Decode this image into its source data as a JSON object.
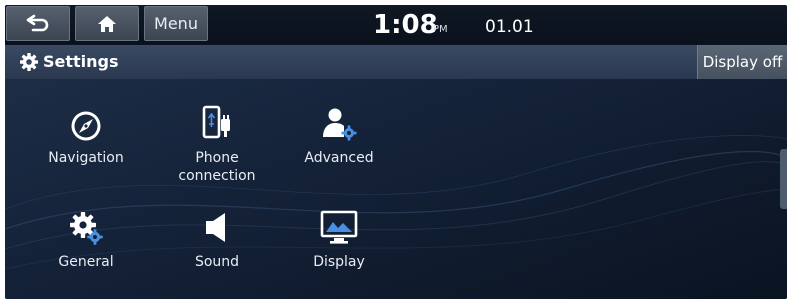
{
  "topbar": {
    "back_icon": "back-arrow-icon",
    "home_icon": "home-icon",
    "menu_label": "Menu",
    "time": "1:08",
    "ampm": "PM",
    "date": "01.01"
  },
  "titlebar": {
    "icon": "gear-icon",
    "title": "Settings",
    "display_off_label": "Display off"
  },
  "items": [
    {
      "label": "Navigation",
      "icon": "compass-icon"
    },
    {
      "label": "Phone\nconnection",
      "icon": "phone-connection-icon"
    },
    {
      "label": "Advanced",
      "icon": "advanced-user-gear-icon"
    },
    {
      "label": "General",
      "icon": "gears-icon"
    },
    {
      "label": "Sound",
      "icon": "speaker-icon"
    },
    {
      "label": "Display",
      "icon": "monitor-icon"
    }
  ],
  "colors": {
    "background": "#0b1422",
    "titlebar": "#2f3e57",
    "accent_blue": "#4a90e2",
    "text": "#ffffff"
  }
}
